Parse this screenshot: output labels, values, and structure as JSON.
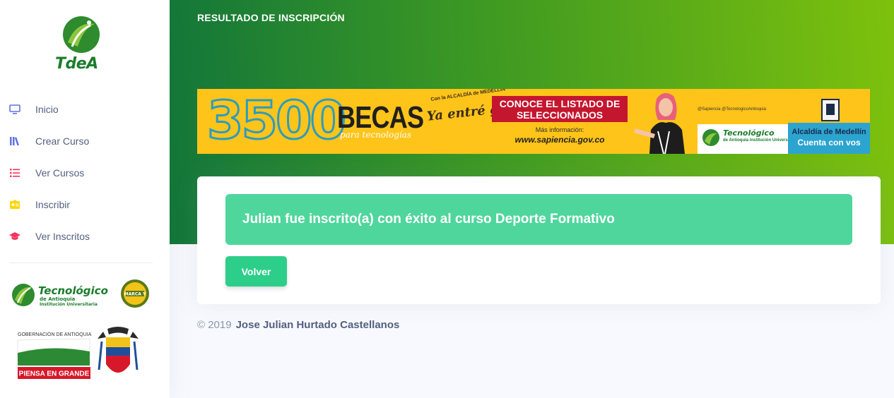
{
  "brand": {
    "name": "TdeA"
  },
  "sidebar": {
    "items": [
      {
        "label": "Inicio",
        "icon": "monitor-icon",
        "color": "#5e72e4"
      },
      {
        "label": "Crear Curso",
        "icon": "books-icon",
        "color": "#5e72e4"
      },
      {
        "label": "Ver Cursos",
        "icon": "list-icon",
        "color": "#f5365c"
      },
      {
        "label": "Inscribir",
        "icon": "id-card-icon",
        "color": "#ffd600"
      },
      {
        "label": "Ver Inscritos",
        "icon": "graduation-cap-icon",
        "color": "#f5365c"
      }
    ],
    "logos": [
      {
        "name": "tecnologico-de-antioquia-logo",
        "text": "Tecnológico de Antioquia Institución Universitaria",
        "badge": "MARCA Y"
      },
      {
        "name": "gobernacion-de-antioquia-logo",
        "text": "GOBERNACIÓN DE ANTIOQUIA",
        "slogan": "PIENSA EN GRANDE"
      }
    ]
  },
  "header": {
    "title": "RESULTADO DE INSCRIPCIÓN"
  },
  "banner": {
    "big_number": "3500",
    "becas": "BECAS",
    "para": "para tecnologías",
    "alcaldia_small": "Con la ALCALDÍA de MEDELLÍN",
    "slogan": "Ya entré ganando",
    "cta": "CONOCE EL LISTADO DE SELECCIONADOS",
    "info_label": "Más información:",
    "info_url": "www.sapiencia.gov.co",
    "social": "@Sapiencia  @TecnologicoAntioquia",
    "tec_name": "Tecnológico",
    "tec_sub": "de Antioquia Institución Universitaria",
    "alcaldia": "Alcaldía de Medellín",
    "cuenta": "Cuenta con vos"
  },
  "result": {
    "message": "Julian fue inscrito(a) con éxito al curso Deporte Formativo",
    "back_button": "Volver"
  },
  "footer": {
    "copyright": "© 2019",
    "author": "Jose Julian Hurtado Castellanos"
  },
  "colors": {
    "accent": "#5e72e4",
    "success": "#2dce89",
    "alert_success": "#4fd69c",
    "header_gradient_start": "#12763a",
    "header_gradient_end": "#7ec10d",
    "banner_bg": "#fec41a"
  }
}
